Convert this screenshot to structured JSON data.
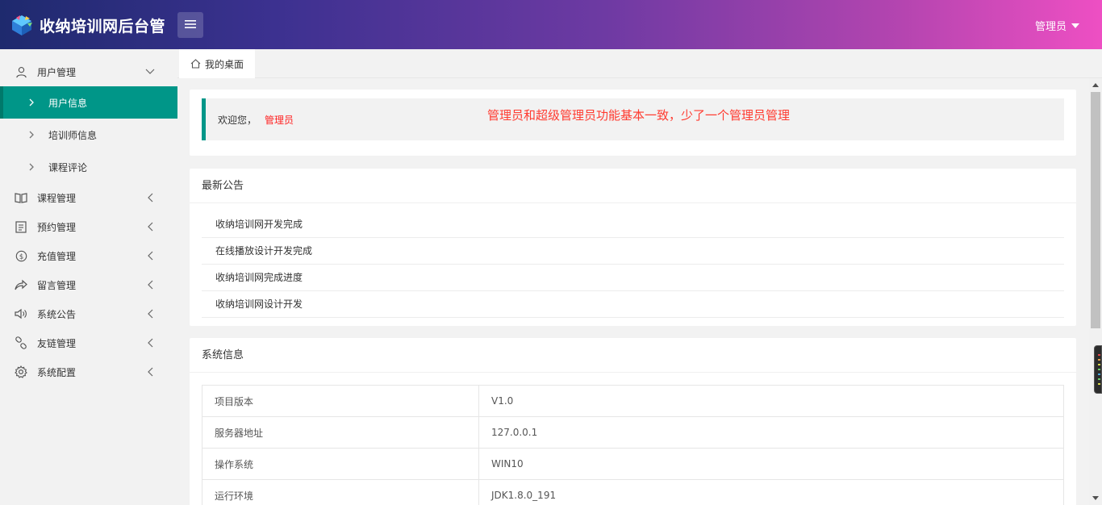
{
  "header": {
    "app_title": "收纳培训网后台管",
    "user_label": "管理员"
  },
  "sidebar": {
    "groups": [
      {
        "label": "用户管理",
        "icon": "user-icon",
        "expanded": true
      },
      {
        "label": "课程管理",
        "icon": "book-icon"
      },
      {
        "label": "预约管理",
        "icon": "calendar-icon"
      },
      {
        "label": "充值管理",
        "icon": "dollar-icon"
      },
      {
        "label": "留言管理",
        "icon": "share-icon"
      },
      {
        "label": "系统公告",
        "icon": "speaker-icon"
      },
      {
        "label": "友链管理",
        "icon": "link-icon"
      },
      {
        "label": "系统配置",
        "icon": "gear-icon"
      }
    ],
    "sub_items": [
      {
        "label": "用户信息",
        "active": true
      },
      {
        "label": "培训师信息"
      },
      {
        "label": "课程评论"
      }
    ]
  },
  "tabs": [
    {
      "label": "我的桌面",
      "icon": "home-icon"
    }
  ],
  "welcome": {
    "greeting": "欢迎您，",
    "username": "管理员",
    "note": "管理员和超级管理员功能基本一致，少了一个管理员管理"
  },
  "notices": {
    "title": "最新公告",
    "items": [
      "收纳培训网开发完成",
      "在线播放设计开发完成",
      "收纳培训网完成进度",
      "收纳培训网设计开发"
    ]
  },
  "system_info": {
    "title": "系统信息",
    "rows": [
      {
        "key": "项目版本",
        "value": "V1.0"
      },
      {
        "key": "服务器地址",
        "value": "127.0.0.1"
      },
      {
        "key": "操作系统",
        "value": "WIN10"
      },
      {
        "key": "运行环境",
        "value": "JDK1.8.0_191"
      }
    ]
  },
  "colors": {
    "accent": "#009688",
    "header_gradient_start": "#1e2a6e",
    "header_gradient_end": "#ee4fc3",
    "note_red": "#ff3b30"
  }
}
